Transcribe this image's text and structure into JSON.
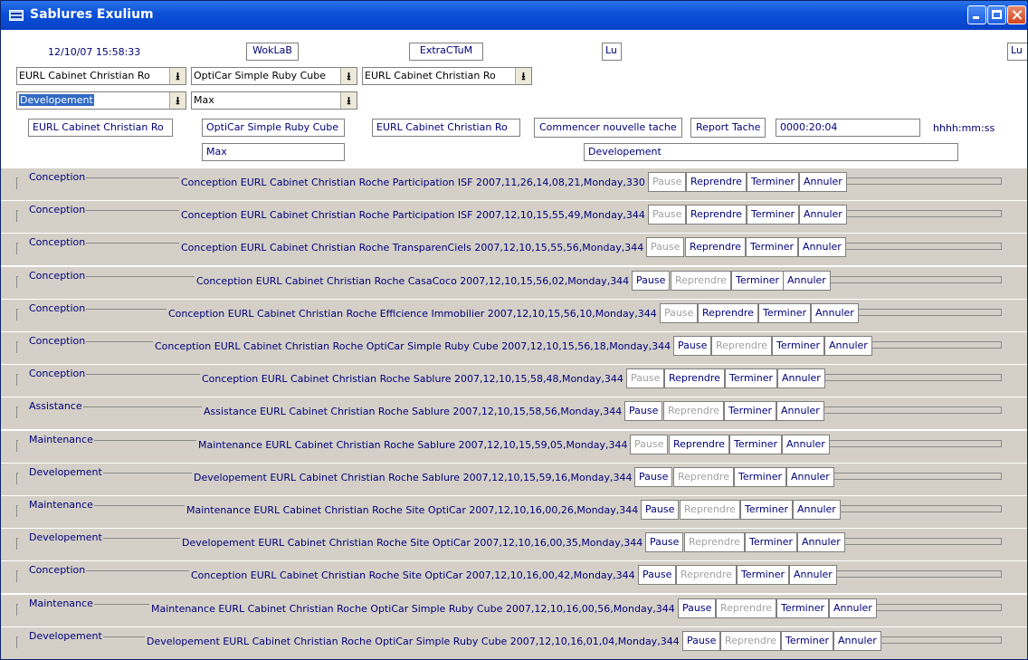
{
  "window": {
    "title": "Sablures Exulium"
  },
  "header": {
    "datetime": "12/10/07 15:58:33",
    "btn_woklab": "WokLaB",
    "btn_extractum": "ExtraCTuM",
    "field_lu": "Lu",
    "field_lu_right": "Lu"
  },
  "combos": {
    "client1": "EURL Cabinet Christian Ro",
    "project1": "OptiCar Simple Ruby Cube",
    "client2": "EURL Cabinet Christian Ro",
    "type": "Developement",
    "user": "Max"
  },
  "summary": {
    "client": "EURL Cabinet Christian Ro",
    "project": "OptiCar Simple Ruby Cube",
    "client2": "EURL Cabinet Christian Ro",
    "user": "Max",
    "type": "Developement",
    "btn_new_task": "Commencer nouvelle tache",
    "btn_report": "Report Tache",
    "timer": "0000:20:04",
    "timer_format": "hhhh:mm:ss"
  },
  "row_buttons": {
    "pause": "Pause",
    "resume": "Reprendre",
    "finish": "Terminer",
    "cancel": "Annuler"
  },
  "tasks": [
    {
      "category": "Conception",
      "text": "Conception EURL Cabinet Christian Roche Participation ISF 2007,11,26,14,08,21,Monday,330",
      "pause_enabled": false,
      "resume_enabled": true
    },
    {
      "category": "Conception",
      "text": "Conception EURL Cabinet Christian Roche Participation ISF 2007,12,10,15,55,49,Monday,344",
      "pause_enabled": false,
      "resume_enabled": true
    },
    {
      "category": "Conception",
      "text": "Conception EURL Cabinet Christian Roche TransparenCiels 2007,12,10,15,55,56,Monday,344",
      "pause_enabled": false,
      "resume_enabled": true
    },
    {
      "category": "Conception",
      "text": "Conception EURL Cabinet Christian Roche CasaCoco 2007,12,10,15,56,02,Monday,344",
      "pause_enabled": true,
      "resume_enabled": false
    },
    {
      "category": "Conception",
      "text": "Conception EURL Cabinet Christian Roche Efficience Immobilier 2007,12,10,15,56,10,Monday,344",
      "pause_enabled": false,
      "resume_enabled": true
    },
    {
      "category": "Conception",
      "text": "Conception EURL Cabinet Christian Roche OptiCar Simple Ruby Cube 2007,12,10,15,56,18,Monday,344",
      "pause_enabled": true,
      "resume_enabled": false
    },
    {
      "category": "Conception",
      "text": "Conception EURL Cabinet Christian Roche Sablure 2007,12,10,15,58,48,Monday,344",
      "pause_enabled": false,
      "resume_enabled": true
    },
    {
      "category": "Assistance",
      "text": "Assistance EURL Cabinet Christian Roche Sablure 2007,12,10,15,58,56,Monday,344",
      "pause_enabled": true,
      "resume_enabled": false
    },
    {
      "category": "Maintenance",
      "text": "Maintenance EURL Cabinet Christian Roche Sablure 2007,12,10,15,59,05,Monday,344",
      "pause_enabled": false,
      "resume_enabled": true
    },
    {
      "category": "Developement",
      "text": "Developement EURL Cabinet Christian Roche Sablure 2007,12,10,15,59,16,Monday,344",
      "pause_enabled": true,
      "resume_enabled": false
    },
    {
      "category": "Maintenance",
      "text": "Maintenance EURL Cabinet Christian Roche Site OptiCar 2007,12,10,16,00,26,Monday,344",
      "pause_enabled": true,
      "resume_enabled": false
    },
    {
      "category": "Developement",
      "text": "Developement EURL Cabinet Christian Roche Site OptiCar 2007,12,10,16,00,35,Monday,344",
      "pause_enabled": true,
      "resume_enabled": false
    },
    {
      "category": "Conception",
      "text": "Conception EURL Cabinet Christian Roche Site OptiCar 2007,12,10,16,00,42,Monday,344",
      "pause_enabled": true,
      "resume_enabled": false
    },
    {
      "category": "Maintenance",
      "text": "Maintenance EURL Cabinet Christian Roche OptiCar Simple Ruby Cube 2007,12,10,16,00,56,Monday,344",
      "pause_enabled": true,
      "resume_enabled": false
    },
    {
      "category": "Developement",
      "text": "Developement EURL Cabinet Christian Roche OptiCar Simple Ruby Cube 2007,12,10,16,01,04,Monday,344",
      "pause_enabled": true,
      "resume_enabled": false
    }
  ]
}
